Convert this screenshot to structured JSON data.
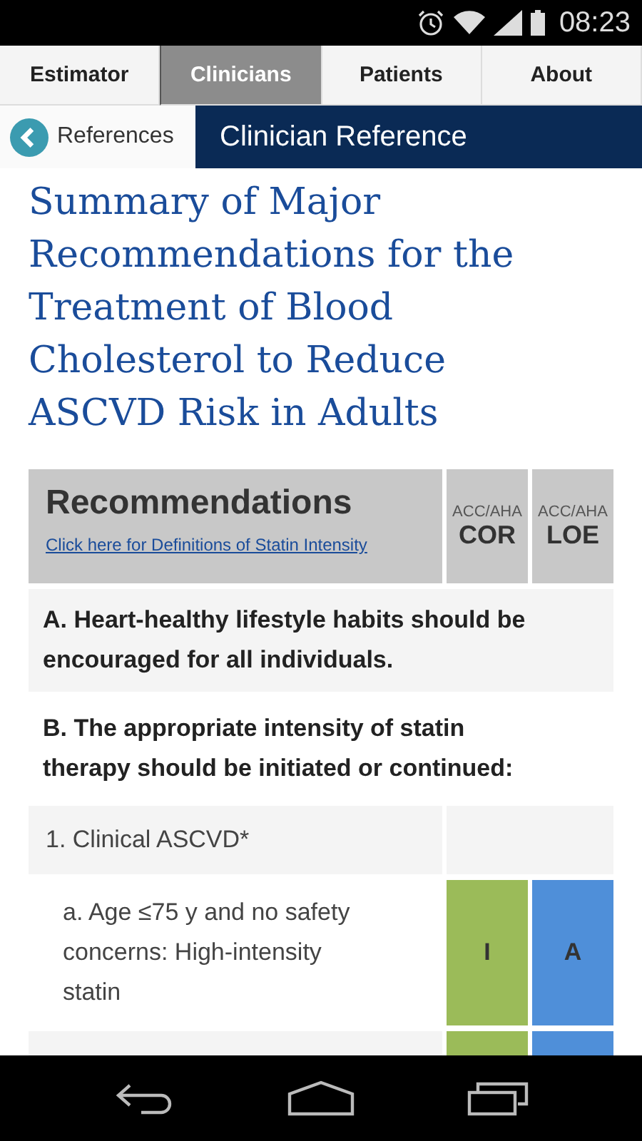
{
  "status_bar": {
    "time": "08:23"
  },
  "tabs": [
    {
      "label": "Estimator",
      "selected": false
    },
    {
      "label": "Clinicians",
      "selected": true
    },
    {
      "label": "Patients",
      "selected": false
    },
    {
      "label": "About",
      "selected": false
    }
  ],
  "header": {
    "back_button": "References",
    "title": "Clinician Reference"
  },
  "page_title": "Summary of Major Recommendations for the Treatment of Blood Cholesterol to Reduce ASCVD Risk in Adults",
  "table": {
    "heading": "Recommendations",
    "link": "Click here for Definitions of Statin Intensity",
    "columns": [
      {
        "caption": "ACC/AHA",
        "label": "COR"
      },
      {
        "caption": "ACC/AHA",
        "label": "LOE"
      }
    ],
    "rows": [
      {
        "kind": "section",
        "text": "A. Heart-healthy lifestyle habits should be encouraged for all individuals."
      },
      {
        "kind": "section",
        "text": "B. The appropriate intensity of statin therapy should be initiated or continued:"
      },
      {
        "kind": "group",
        "text": "1. Clinical ASCVD*"
      },
      {
        "kind": "item",
        "text": "a. Age ≤75 y and no safety concerns: High-intensity statin",
        "cor": "I",
        "loe": "A"
      },
      {
        "kind": "partial"
      }
    ]
  }
}
